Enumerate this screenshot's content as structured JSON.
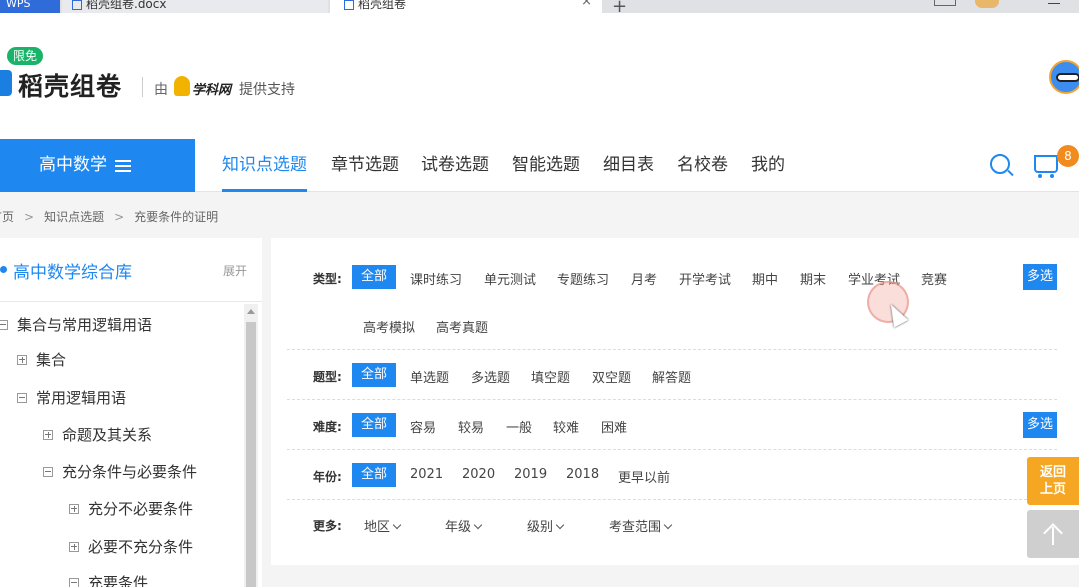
{
  "browser": {
    "tabs": [
      "WPS",
      "稻壳组卷.docx",
      "稻壳组卷"
    ],
    "new_tab": "+",
    "close": "×"
  },
  "header": {
    "badge": "限免",
    "logo_text": "稻壳组卷",
    "by": "由",
    "partner": "学科网",
    "support": "提供支持"
  },
  "nav": {
    "subject": "高中数学",
    "items": [
      "知识点选题",
      "章节选题",
      "试卷选题",
      "智能选题",
      "细目表",
      "名校卷",
      "我的"
    ],
    "active_index": 0,
    "cart_count": "8"
  },
  "breadcrumb": [
    "首页",
    "知识点选题",
    "充要条件的证明"
  ],
  "breadcrumb_sep": ">",
  "sidebar": {
    "title": "高中数学综合库",
    "expand": "展开",
    "tree": [
      {
        "label": "集合与常用逻辑用语",
        "level": 0,
        "state": "minus"
      },
      {
        "label": "集合",
        "level": 1,
        "state": "plus"
      },
      {
        "label": "常用逻辑用语",
        "level": 1,
        "state": "minus"
      },
      {
        "label": "命题及其关系",
        "level": 2,
        "state": "plus"
      },
      {
        "label": "充分条件与必要条件",
        "level": 2,
        "state": "minus"
      },
      {
        "label": "充分不必要条件",
        "level": 3,
        "state": "plus"
      },
      {
        "label": "必要不充分条件",
        "level": 3,
        "state": "plus"
      },
      {
        "label": "充要条件",
        "level": 3,
        "state": "minus"
      }
    ]
  },
  "filters": {
    "type_label": "类型:",
    "type_options": [
      "全部",
      "课时练习",
      "单元测试",
      "专题练习",
      "月考",
      "开学考试",
      "期中",
      "期末",
      "学业考试",
      "竞赛",
      "高考模拟",
      "高考真题"
    ],
    "question_label": "题型:",
    "question_options": [
      "全部",
      "单选题",
      "多选题",
      "填空题",
      "双空题",
      "解答题"
    ],
    "difficulty_label": "难度:",
    "difficulty_options": [
      "全部",
      "容易",
      "较易",
      "一般",
      "较难",
      "困难"
    ],
    "year_label": "年份:",
    "year_options": [
      "全部",
      "2021",
      "2020",
      "2019",
      "2018",
      "更早以前"
    ],
    "more_label": "更多:",
    "more_options": [
      "地区",
      "年级",
      "级别",
      "考查范围"
    ],
    "multi_select": "多选"
  },
  "floating": {
    "back_line1": "返回",
    "back_line2": "上页"
  }
}
